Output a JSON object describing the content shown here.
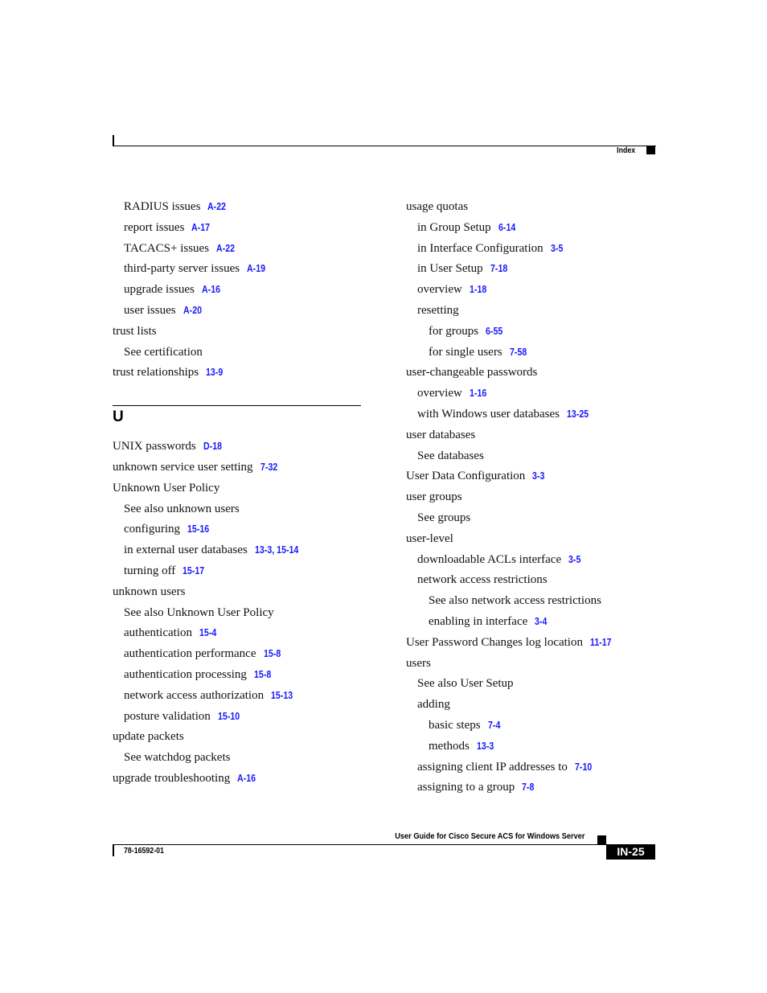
{
  "header": {
    "section_label": "Index"
  },
  "left_column": {
    "entries_before": [
      {
        "level": 2,
        "text": "RADIUS issues",
        "refs": "A-22"
      },
      {
        "level": 2,
        "text": "report issues",
        "refs": "A-17"
      },
      {
        "level": 2,
        "text": "TACACS+ issues",
        "refs": "A-22"
      },
      {
        "level": 2,
        "text": "third-party server issues",
        "refs": "A-19"
      },
      {
        "level": 2,
        "text": "upgrade issues",
        "refs": "A-16"
      },
      {
        "level": 2,
        "text": "user issues",
        "refs": "A-20"
      },
      {
        "level": 1,
        "text": "trust lists",
        "refs": ""
      },
      {
        "level": 2,
        "text": "See certification",
        "refs": ""
      },
      {
        "level": 1,
        "text": "trust relationships",
        "refs": "13-9"
      }
    ],
    "section_letter": "U",
    "entries_after": [
      {
        "level": 1,
        "text": "UNIX passwords",
        "refs": "D-18"
      },
      {
        "level": 1,
        "text": "unknown service user setting",
        "refs": "7-32"
      },
      {
        "level": 1,
        "text": "Unknown User Policy",
        "refs": ""
      },
      {
        "level": 2,
        "text": "See also unknown users",
        "refs": ""
      },
      {
        "level": 2,
        "text": "configuring",
        "refs": "15-16"
      },
      {
        "level": 2,
        "text": "in external user databases",
        "refs": "13-3, 15-14"
      },
      {
        "level": 2,
        "text": "turning off",
        "refs": "15-17"
      },
      {
        "level": 1,
        "text": "unknown users",
        "refs": ""
      },
      {
        "level": 2,
        "text": "See also Unknown User Policy",
        "refs": ""
      },
      {
        "level": 2,
        "text": "authentication",
        "refs": "15-4"
      },
      {
        "level": 2,
        "text": "authentication performance",
        "refs": "15-8"
      },
      {
        "level": 2,
        "text": "authentication processing",
        "refs": "15-8"
      },
      {
        "level": 2,
        "text": "network access authorization",
        "refs": "15-13"
      },
      {
        "level": 2,
        "text": "posture validation",
        "refs": "15-10"
      },
      {
        "level": 1,
        "text": "update packets",
        "refs": ""
      },
      {
        "level": 2,
        "text": "See watchdog packets",
        "refs": ""
      },
      {
        "level": 1,
        "text": "upgrade troubleshooting",
        "refs": "A-16"
      }
    ]
  },
  "right_column": {
    "entries": [
      {
        "level": 1,
        "text": "usage quotas",
        "refs": ""
      },
      {
        "level": 2,
        "text": "in Group Setup",
        "refs": "6-14"
      },
      {
        "level": 2,
        "text": "in Interface Configuration",
        "refs": "3-5"
      },
      {
        "level": 2,
        "text": "in User Setup",
        "refs": "7-18"
      },
      {
        "level": 2,
        "text": "overview",
        "refs": "1-18"
      },
      {
        "level": 2,
        "text": "resetting",
        "refs": ""
      },
      {
        "level": 3,
        "text": "for groups",
        "refs": "6-55"
      },
      {
        "level": 3,
        "text": "for single users",
        "refs": "7-58"
      },
      {
        "level": 1,
        "text": "user-changeable passwords",
        "refs": ""
      },
      {
        "level": 2,
        "text": "overview",
        "refs": "1-16"
      },
      {
        "level": 2,
        "text": "with Windows user databases",
        "refs": "13-25"
      },
      {
        "level": 1,
        "text": "user databases",
        "refs": ""
      },
      {
        "level": 2,
        "text": "See databases",
        "refs": ""
      },
      {
        "level": 1,
        "text": "User Data Configuration",
        "refs": "3-3"
      },
      {
        "level": 1,
        "text": "user groups",
        "refs": ""
      },
      {
        "level": 2,
        "text": "See groups",
        "refs": ""
      },
      {
        "level": 1,
        "text": "user-level",
        "refs": ""
      },
      {
        "level": 2,
        "text": "downloadable ACLs interface",
        "refs": "3-5"
      },
      {
        "level": 2,
        "text": "network access restrictions",
        "refs": ""
      },
      {
        "level": 3,
        "text": "See also network access restrictions",
        "refs": ""
      },
      {
        "level": 3,
        "text": "enabling in interface",
        "refs": "3-4"
      },
      {
        "level": 1,
        "text": "User Password Changes log location",
        "refs": "11-17"
      },
      {
        "level": 1,
        "text": "users",
        "refs": ""
      },
      {
        "level": 2,
        "text": "See also User Setup",
        "refs": ""
      },
      {
        "level": 2,
        "text": "adding",
        "refs": ""
      },
      {
        "level": 3,
        "text": "basic steps",
        "refs": "7-4"
      },
      {
        "level": 3,
        "text": "methods",
        "refs": "13-3"
      },
      {
        "level": 2,
        "text": "assigning client IP addresses to",
        "refs": "7-10"
      },
      {
        "level": 2,
        "text": "assigning to a group",
        "refs": "7-8"
      }
    ]
  },
  "footer": {
    "book_title": "User Guide for Cisco Secure ACS for Windows Server",
    "doc_number": "78-16592-01",
    "page_number": "IN-25"
  },
  "colors": {
    "link": "#1a1aff",
    "text": "#111111"
  }
}
